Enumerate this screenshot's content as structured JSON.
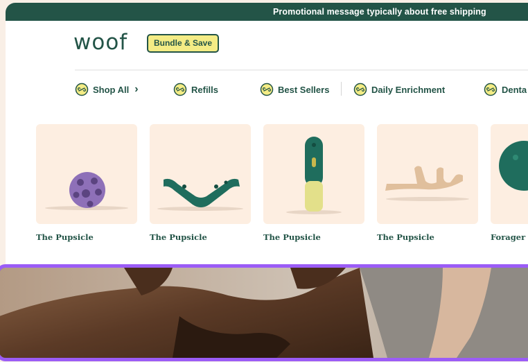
{
  "promo": {
    "message": "Promotional message typically about free shipping"
  },
  "header": {
    "logo": "woof",
    "bundle_label": "Bundle & Save"
  },
  "nav": {
    "items": [
      {
        "label": "Shop All",
        "icon": "bone-icon",
        "has_chevron": true
      },
      {
        "label": "Refills",
        "icon": "bone-icon"
      },
      {
        "label": "Best Sellers",
        "icon": "bone-icon"
      },
      {
        "label": "Daily Enrichment",
        "icon": "bone-icon"
      },
      {
        "label": "Denta",
        "icon": "bone-icon"
      }
    ],
    "chevron": "›"
  },
  "products": [
    {
      "title": "The Pupsicle",
      "image": "purple-treat-ball"
    },
    {
      "title": "The Pupsicle",
      "image": "green-chew-bone"
    },
    {
      "title": "The Pupsicle",
      "image": "green-treat-tube"
    },
    {
      "title": "The Pupsicle",
      "image": "antler-chew"
    },
    {
      "title": "Forager C",
      "image": "green-ball"
    }
  ],
  "colors": {
    "brand_green": "#235447",
    "accent_yellow": "#f4ec85",
    "card_background": "#fdeee1",
    "hero_border": "#9b5cf6"
  }
}
